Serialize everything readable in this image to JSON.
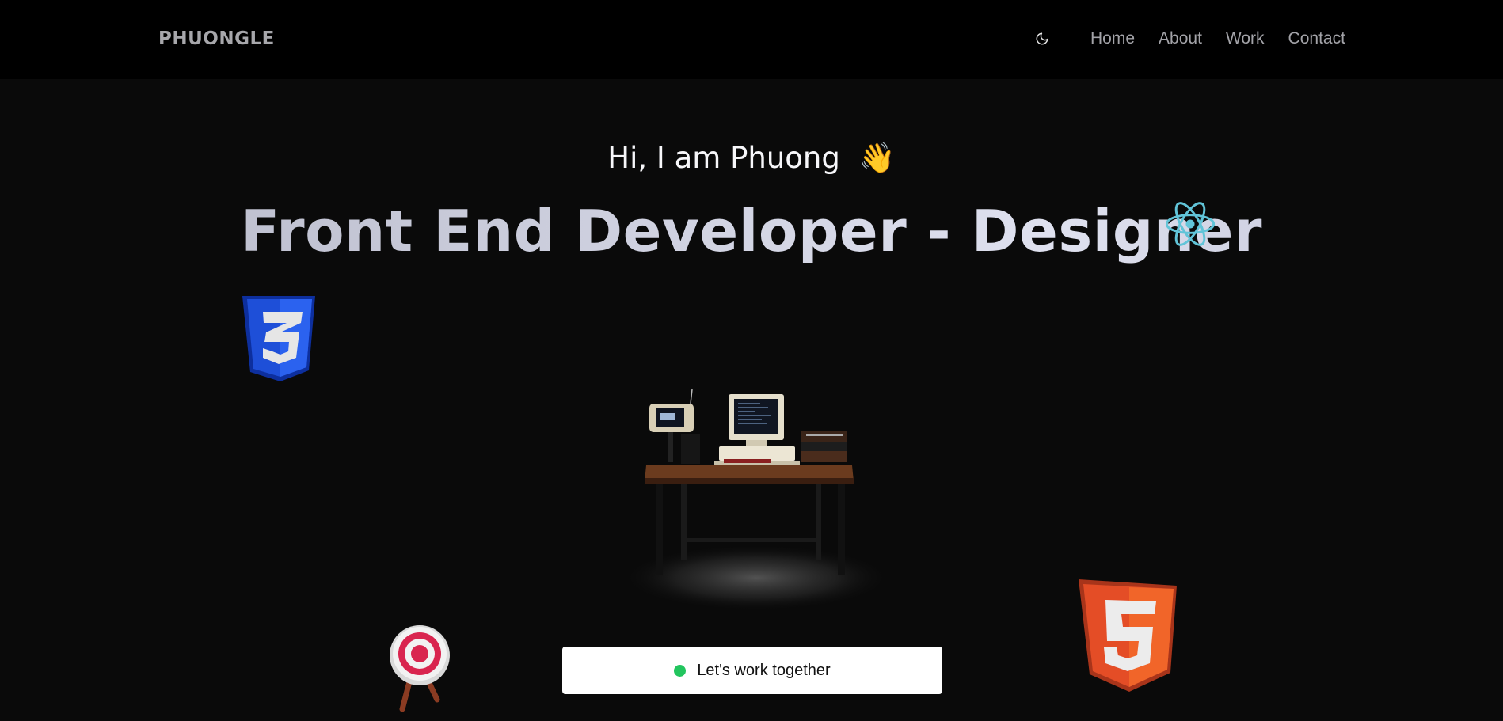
{
  "brand": {
    "logo_text": "PHUONGLE"
  },
  "nav": {
    "theme_toggle_icon": "moon-icon",
    "links": [
      {
        "label": "Home"
      },
      {
        "label": "About"
      },
      {
        "label": "Work"
      },
      {
        "label": "Contact"
      }
    ]
  },
  "hero": {
    "greeting": "Hi, I am Phuong",
    "wave_emoji": "👋",
    "headline": "Front End Developer - Designer"
  },
  "decorations": {
    "css_logo_icon": "css3-logo-icon",
    "html_logo_icon": "html5-logo-icon",
    "react_logo_icon": "react-logo-icon",
    "target_icon": "target-icon",
    "desk_scene": "computer-desk-illustration"
  },
  "cta": {
    "label": "Let's work together",
    "status_color": "#22c55e"
  },
  "colors": {
    "nav_bg": "#000000",
    "page_bg": "#0a0a0a",
    "css_blue": "#1e4fd8",
    "html_orange": "#e44d26",
    "react_cyan": "#61dafb"
  }
}
